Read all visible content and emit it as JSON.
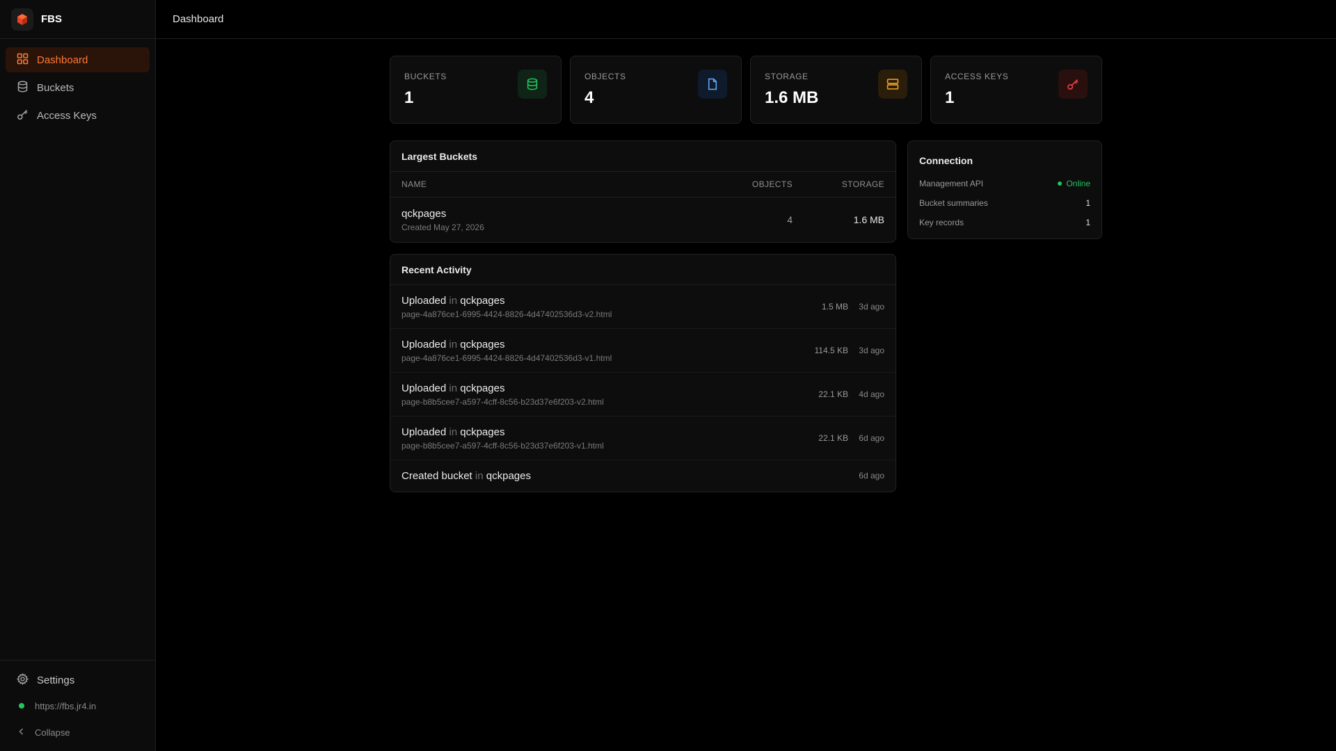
{
  "app": {
    "name": "FBS"
  },
  "sidebar": {
    "items": [
      {
        "label": "Dashboard",
        "icon": "grid-icon",
        "active": true
      },
      {
        "label": "Buckets",
        "icon": "database-icon",
        "active": false
      },
      {
        "label": "Access Keys",
        "icon": "key-icon",
        "active": false
      }
    ],
    "bottom": {
      "settings_label": "Settings",
      "server_url": "https://fbs.jr4.in",
      "collapse_label": "Collapse"
    }
  },
  "topbar": {
    "title": "Dashboard"
  },
  "stats": [
    {
      "label": "BUCKETS",
      "value": "1",
      "icon": "database-icon",
      "color": "#22c55e",
      "bg": "#0f2417"
    },
    {
      "label": "OBJECTS",
      "value": "4",
      "icon": "file-icon",
      "color": "#60a5fa",
      "bg": "#0f1a2b"
    },
    {
      "label": "STORAGE",
      "value": "1.6 MB",
      "icon": "server-icon",
      "color": "#f5a524",
      "bg": "#2a1d0a"
    },
    {
      "label": "ACCESS KEYS",
      "value": "1",
      "icon": "key-icon",
      "color": "#ef4444",
      "bg": "#2a0f0f"
    }
  ],
  "largest_buckets": {
    "title": "Largest Buckets",
    "columns": {
      "name": "NAME",
      "objects": "OBJECTS",
      "storage": "STORAGE"
    },
    "rows": [
      {
        "name": "qckpages",
        "created": "Created May 27, 2026",
        "objects": "4",
        "storage": "1.6 MB"
      }
    ]
  },
  "recent_activity": {
    "title": "Recent Activity",
    "in_word": "in",
    "items": [
      {
        "action": "Uploaded",
        "bucket": "qckpages",
        "file": "page-4a876ce1-6995-4424-8826-4d47402536d3-v2.html",
        "size": "1.5 MB",
        "time": "3d ago"
      },
      {
        "action": "Uploaded",
        "bucket": "qckpages",
        "file": "page-4a876ce1-6995-4424-8826-4d47402536d3-v1.html",
        "size": "114.5 KB",
        "time": "3d ago"
      },
      {
        "action": "Uploaded",
        "bucket": "qckpages",
        "file": "page-b8b5cee7-a597-4cff-8c56-b23d37e6f203-v2.html",
        "size": "22.1 KB",
        "time": "4d ago"
      },
      {
        "action": "Uploaded",
        "bucket": "qckpages",
        "file": "page-b8b5cee7-a597-4cff-8c56-b23d37e6f203-v1.html",
        "size": "22.1 KB",
        "time": "6d ago"
      },
      {
        "action": "Created bucket",
        "bucket": "qckpages",
        "file": "",
        "size": "",
        "time": "6d ago"
      }
    ]
  },
  "connection": {
    "title": "Connection",
    "rows": [
      {
        "key": "Management API",
        "value": "Online",
        "status_color": "#22c55e"
      },
      {
        "key": "Bucket summaries",
        "value": "1"
      },
      {
        "key": "Key records",
        "value": "1"
      }
    ]
  },
  "colors": {
    "accent": "#ff7a33",
    "active_bg": "#2a1309",
    "online": "#22c55e"
  }
}
